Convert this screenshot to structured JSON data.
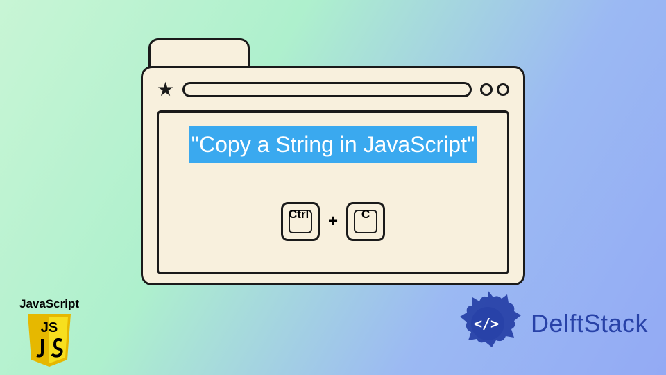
{
  "main": {
    "highlighted_text": "\"Copy a String in JavaScript\"",
    "key1": "Ctrl",
    "plus": "+",
    "key2": "C"
  },
  "js_badge": {
    "label": "JavaScript",
    "shield_top": "JS"
  },
  "delftstack": {
    "text": "DelftStack"
  },
  "colors": {
    "highlight_bg": "#3aa9ef",
    "window_bg": "#f8f0dd",
    "js_yellow": "#f7df1e",
    "delft_blue": "#2842a8"
  }
}
